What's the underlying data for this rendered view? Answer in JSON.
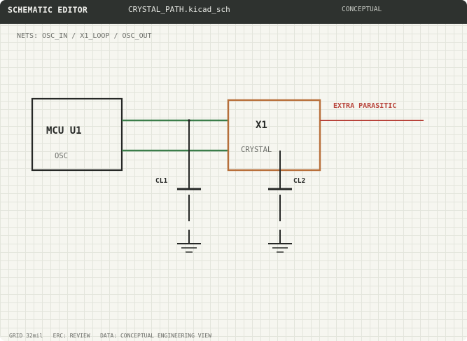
{
  "titlebar": {
    "app_title": "SCHEMATIC EDITOR",
    "file_name": "CRYSTAL_PATH.kicad_sch",
    "mode": "CONCEPTUAL"
  },
  "nets_label": "NETS: OSC_IN / X1_LOOP / OSC_OUT",
  "components": {
    "mcu": {
      "ref": "MCU U1",
      "pin_label": "OSC"
    },
    "crystal": {
      "ref": "X1",
      "value": "CRYSTAL"
    },
    "cl1": {
      "ref": "CL1"
    },
    "cl2": {
      "ref": "CL2"
    }
  },
  "annotations": {
    "parasitic": "EXTRA PARASITIC"
  },
  "status_bar": {
    "grid": "GRID 32mil",
    "erc": "ERC: REVIEW",
    "data": "DATA: CONCEPTUAL ENGINEERING VIEW"
  },
  "colors": {
    "wire_green": "#3b7d4a",
    "crystal_outline": "#b86f3a",
    "parasitic_red": "#b8443b",
    "titlebar_bg": "#2e322f"
  }
}
